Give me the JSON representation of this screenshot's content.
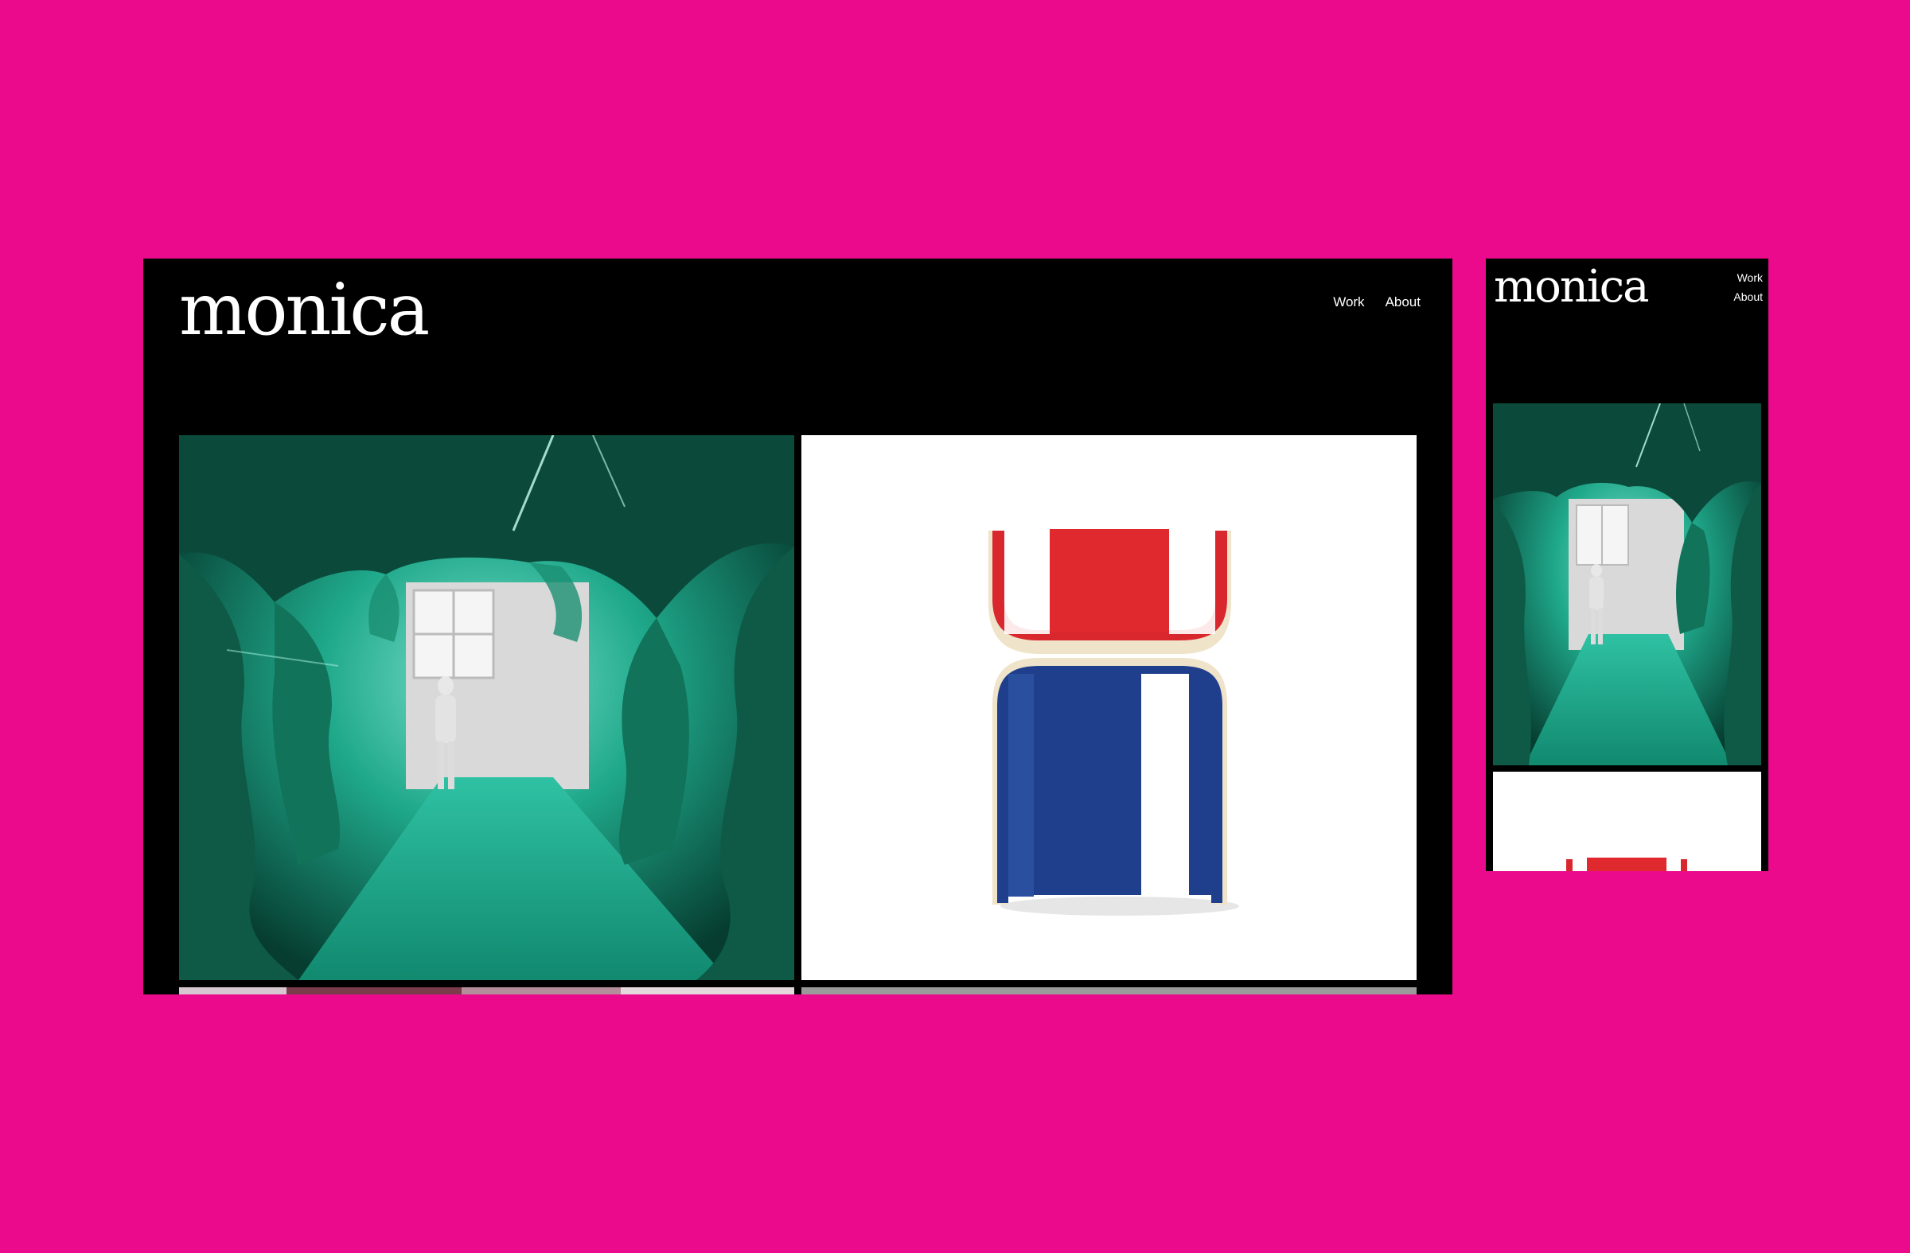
{
  "brand": {
    "name": "monica"
  },
  "nav": {
    "items": [
      {
        "label": "Work"
      },
      {
        "label": "About"
      }
    ]
  },
  "colors": {
    "background": "#eb0a8c",
    "frame": "#000000",
    "text": "#ffffff",
    "accent_red": "#d9272e",
    "accent_blue": "#1f3f8c",
    "cave_green": "#0f8c6e"
  },
  "work_tiles": [
    {
      "icon": "green-cave-installation-image"
    },
    {
      "icon": "red-white-blue-chair-image"
    }
  ]
}
